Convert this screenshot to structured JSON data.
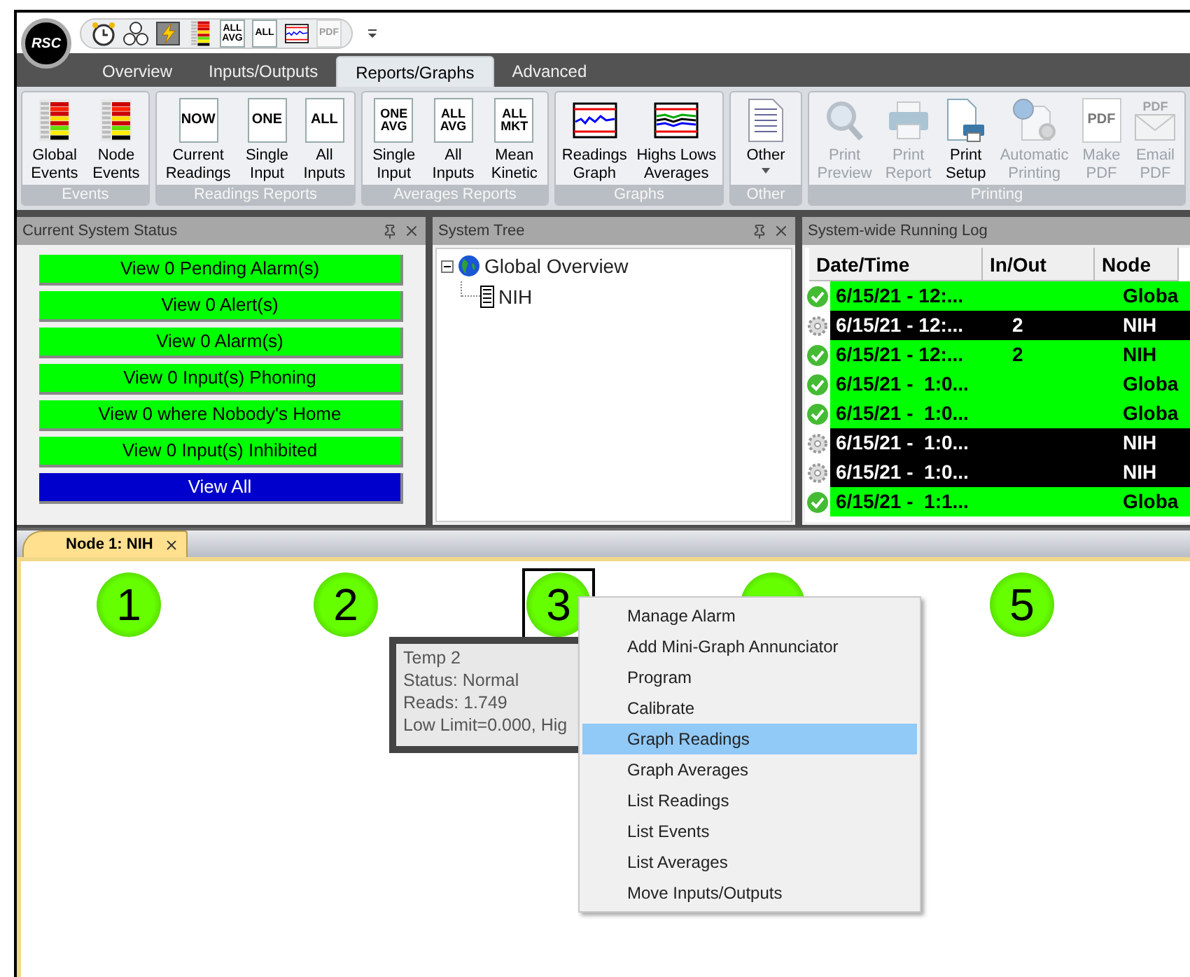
{
  "app_logo": "RSC",
  "quick_access": [
    {
      "kind": "clock",
      "disabled": false
    },
    {
      "kind": "clocks",
      "disabled": false
    },
    {
      "kind": "lightning",
      "disabled": false
    },
    {
      "kind": "events",
      "disabled": false
    },
    {
      "kind": "text",
      "icon_text": "ALL\nAVG",
      "disabled": false
    },
    {
      "kind": "text",
      "icon_text": "ALL",
      "disabled": false
    },
    {
      "kind": "graph",
      "disabled": false
    },
    {
      "kind": "text",
      "icon_text": "PDF",
      "disabled": true
    }
  ],
  "menu_tabs": [
    {
      "label": "Overview",
      "selected": false
    },
    {
      "label": "Inputs/Outputs",
      "selected": false
    },
    {
      "label": "Reports/Graphs",
      "selected": true
    },
    {
      "label": "Advanced",
      "selected": false
    }
  ],
  "ribbon": {
    "groups": [
      {
        "label": "Events",
        "buttons": [
          {
            "label": "Global\nEvents",
            "kind": "events",
            "disabled": false
          },
          {
            "label": "Node\nEvents",
            "kind": "events",
            "disabled": false
          }
        ]
      },
      {
        "label": "Readings Reports",
        "buttons": [
          {
            "label": "Current\nReadings",
            "kind": "doc",
            "icon_text": "NOW",
            "disabled": false
          },
          {
            "label": "Single\nInput",
            "kind": "doc",
            "icon_text": "ONE",
            "disabled": false
          },
          {
            "label": "All\nInputs",
            "kind": "doc",
            "icon_text": "ALL",
            "disabled": false
          }
        ]
      },
      {
        "label": "Averages Reports",
        "buttons": [
          {
            "label": "Single\nInput",
            "kind": "doc",
            "icon_text": "ONE\nAVG",
            "disabled": false
          },
          {
            "label": "All\nInputs",
            "kind": "doc",
            "icon_text": "ALL\nAVG",
            "disabled": false
          },
          {
            "label": "Mean\nKinetic",
            "kind": "doc",
            "icon_text": "ALL\nMKT",
            "disabled": false
          }
        ]
      },
      {
        "label": "Graphs",
        "buttons": [
          {
            "label": "Readings\nGraph",
            "kind": "graph",
            "disabled": false
          },
          {
            "label": "Highs Lows\nAverages",
            "kind": "graph2",
            "disabled": false
          }
        ]
      },
      {
        "label": "Other",
        "buttons": [
          {
            "label": "Other",
            "kind": "lines",
            "dropdown": true,
            "disabled": false
          }
        ]
      },
      {
        "label": "Printing",
        "buttons": [
          {
            "label": "Print\nPreview",
            "kind": "magnifier",
            "disabled": true
          },
          {
            "label": "Print\nReport",
            "kind": "printer",
            "disabled": true
          },
          {
            "label": "Print\nSetup",
            "kind": "setup",
            "disabled": false
          },
          {
            "label": "Automatic\nPrinting",
            "kind": "auto",
            "disabled": true
          },
          {
            "label": "Make\nPDF",
            "kind": "doc",
            "icon_text": "PDF",
            "disabled": true
          },
          {
            "label": "Email\nPDF",
            "kind": "envelope",
            "icon_text": "PDF",
            "disabled": true
          }
        ]
      }
    ]
  },
  "status_panel": {
    "title": "Current System Status",
    "buttons": [
      {
        "label": "View 0 Pending Alarm(s)",
        "color": "#00ff00"
      },
      {
        "label": "View 0 Alert(s)",
        "color": "#00ff00"
      },
      {
        "label": "View 0 Alarm(s)",
        "color": "#00ff00"
      },
      {
        "label": "View 0 Input(s) Phoning",
        "color": "#00ff00"
      },
      {
        "label": "View 0 where Nobody's Home",
        "color": "#00ff00"
      },
      {
        "label": "View 0 Input(s) Inhibited",
        "color": "#00ff00"
      },
      {
        "label": "View All",
        "color": "#0000cc"
      }
    ]
  },
  "tree_panel": {
    "title": "System Tree",
    "items": [
      {
        "label": "Global Overview",
        "kind": "globe",
        "expanded": true,
        "children": [
          {
            "label": "NIH",
            "kind": "device"
          }
        ]
      }
    ]
  },
  "log_panel": {
    "title": "System-wide Running Log",
    "columns": [
      "Date/Time",
      "In/Out",
      "Node"
    ],
    "rows": [
      {
        "kind": "check",
        "color": "#00ff00",
        "date": "6/15/21 - 12:...",
        "node": "Globa"
      },
      {
        "kind": "gear",
        "color": "#000000",
        "date": "6/15/21 - 12:...",
        "in_out": "2",
        "node": "NIH"
      },
      {
        "kind": "check",
        "color": "#00ff00",
        "date": "6/15/21 - 12:...",
        "in_out": "2",
        "node": "NIH"
      },
      {
        "kind": "check",
        "color": "#00ff00",
        "date": "6/15/21 -  1:0...",
        "node": "Globa"
      },
      {
        "kind": "check",
        "color": "#00ff00",
        "date": "6/15/21 -  1:0...",
        "node": "Globa"
      },
      {
        "kind": "gear",
        "color": "#000000",
        "date": "6/15/21 -  1:0...",
        "node": "NIH"
      },
      {
        "kind": "gear",
        "color": "#000000",
        "date": "6/15/21 -  1:0...",
        "node": "NIH"
      },
      {
        "kind": "check",
        "color": "#00ff00",
        "date": "6/15/21 -  1:1...",
        "node": "Globa"
      }
    ]
  },
  "document_tabs": [
    {
      "label": "Node 1: NIH",
      "selected": true
    }
  ],
  "canvas": {
    "nodes": [
      {
        "label": "1",
        "selected": false
      },
      {
        "label": "2",
        "selected": false
      },
      {
        "label": "3",
        "selected": true
      },
      {
        "selected": false
      },
      {
        "label": "5",
        "selected": false
      }
    ],
    "tooltip": {
      "lines": [
        "Temp 2",
        "Status: Normal",
        "Reads: 1.749",
        "Low Limit=0.000, Hig"
      ]
    },
    "context_menu": {
      "items": [
        {
          "label": "Manage Alarm",
          "selected": false
        },
        {
          "label": "Add Mini-Graph Annunciator",
          "selected": false
        },
        {
          "label": "Program",
          "selected": false
        },
        {
          "label": "Calibrate",
          "selected": false
        },
        {
          "label": "Graph Readings",
          "selected": true
        },
        {
          "label": "Graph Averages",
          "selected": false
        },
        {
          "label": "List Readings",
          "selected": false
        },
        {
          "label": "List Events",
          "selected": false
        },
        {
          "label": "List Averages",
          "selected": false
        },
        {
          "label": "Move Inputs/Outputs",
          "selected": false
        }
      ]
    }
  }
}
